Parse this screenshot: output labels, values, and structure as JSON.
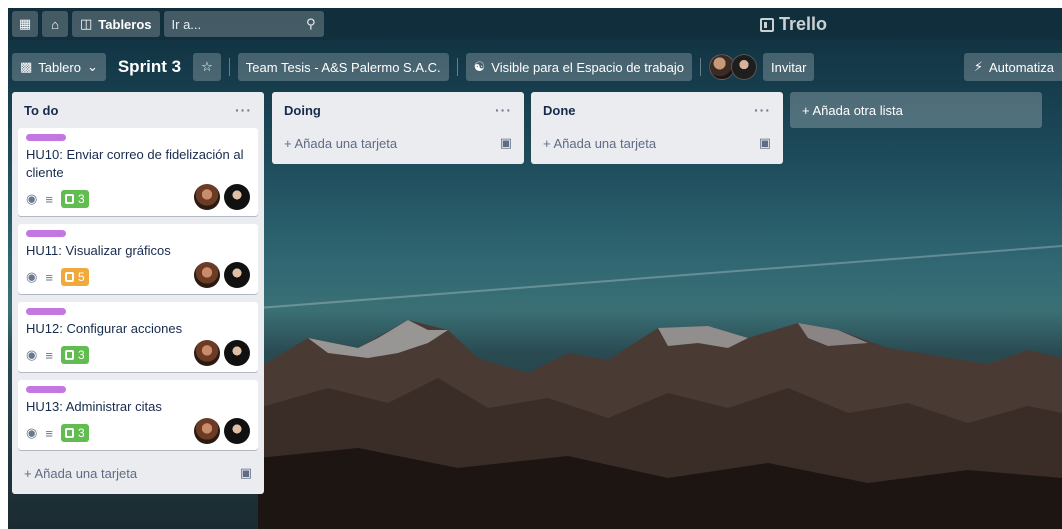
{
  "header": {
    "boards_label": "Tableros",
    "search_placeholder": "Ir a...",
    "logo": "Trello"
  },
  "board_bar": {
    "view_label": "Tablero",
    "title": "Sprint 3",
    "workspace": "Team Tesis - A&S Palermo S.A.C.",
    "visibility": "Visible para el Espacio de trabajo",
    "invite": "Invitar",
    "automation": "Automatiza"
  },
  "lists": [
    {
      "title": "To do",
      "cards": [
        {
          "title": "HU10: Enviar correo de fidelización al cliente",
          "checklist": "3",
          "checklist_color": "#61bd4f"
        },
        {
          "title": "HU11: Visualizar gráficos",
          "checklist": "5",
          "checklist_color": "#f2a93b"
        },
        {
          "title": "HU12: Configurar acciones",
          "checklist": "3",
          "checklist_color": "#61bd4f"
        },
        {
          "title": "HU13: Administrar citas",
          "checklist": "3",
          "checklist_color": "#61bd4f"
        }
      ],
      "add_card": "+ Añada una tarjeta"
    },
    {
      "title": "Doing",
      "cards": [],
      "add_card": "+ Añada una tarjeta"
    },
    {
      "title": "Done",
      "cards": [],
      "add_card": "+ Añada una tarjeta"
    }
  ],
  "add_list": "+ Añada otra lista",
  "icons": [
    "apps-grid-icon",
    "home-icon",
    "boards-icon",
    "search-icon",
    "chevron-down-icon",
    "star-icon",
    "visibility-icon",
    "lightning-icon",
    "eye-icon",
    "description-icon",
    "checklist-icon",
    "template-icon"
  ]
}
